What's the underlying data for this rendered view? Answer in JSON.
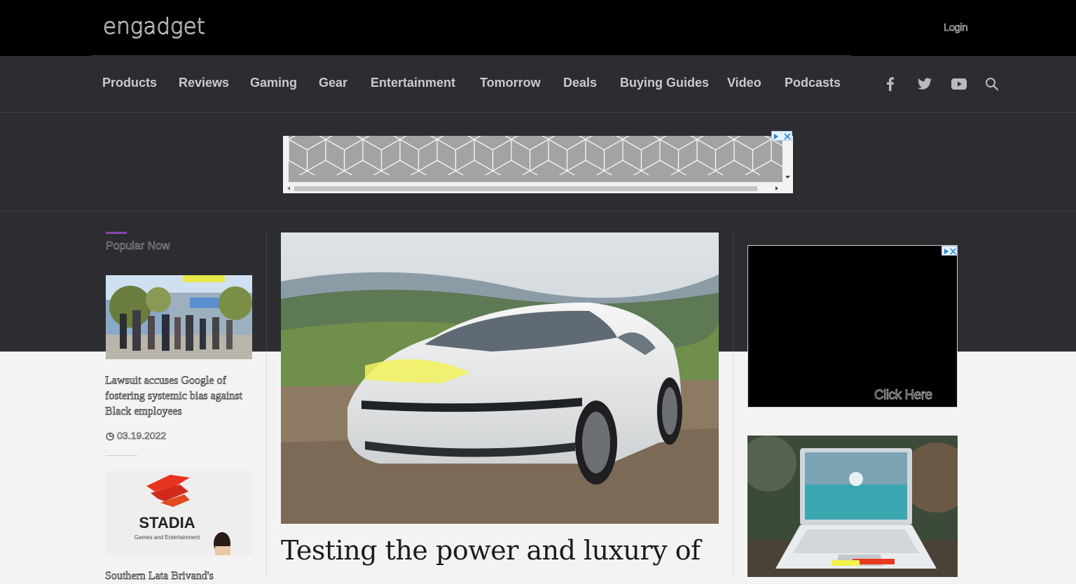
{
  "header": {
    "logo": "engadget",
    "login_label": "Login"
  },
  "nav": {
    "items": [
      "Products",
      "Reviews",
      "Gaming",
      "Gear",
      "Entertainment",
      "Tomorrow",
      "Deals",
      "Buying Guides",
      "Video",
      "Podcasts"
    ],
    "social_icons": [
      "facebook-icon",
      "twitter-icon",
      "youtube-icon",
      "search-icon"
    ]
  },
  "popular": {
    "title": "Popular Now",
    "items": [
      {
        "headline": "Lawsuit accuses Google of fostering systemic bias against Black employees",
        "date": "03.19.2022",
        "image": "Google campus with people walking"
      },
      {
        "headline": "Southern Lata Brivand's",
        "image_text": "STADIA",
        "image_subtext": "Games and Entertainment"
      }
    ]
  },
  "main": {
    "hero_image": "white Lucid Air sedan parked on a hillside",
    "headline": "Testing the power and luxury of"
  },
  "side_ad": {
    "cta": "Click Here"
  },
  "colors": {
    "dark_band": "#2c2d31",
    "accent": "#8e44ad",
    "nav_text": "#c9cacd"
  }
}
